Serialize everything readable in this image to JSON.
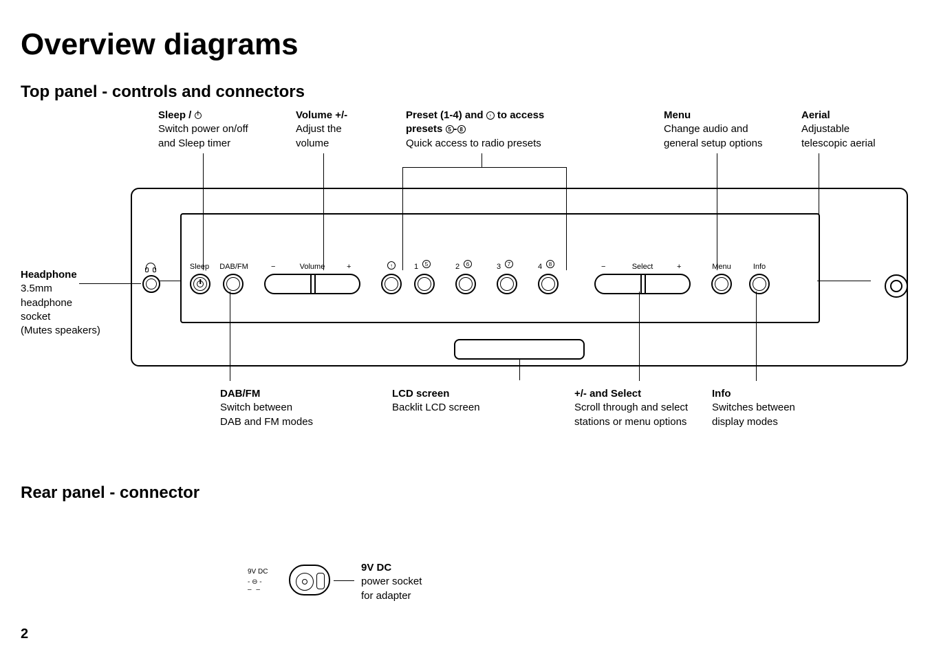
{
  "title": "Overview diagrams",
  "section1_title": "Top panel - controls  and connectors",
  "section2_title": "Rear panel - connector",
  "page_number": "2",
  "top_callouts": {
    "sleep": {
      "title": "Sleep / ",
      "desc1": "Switch power on/off",
      "desc2": "and Sleep timer"
    },
    "volume": {
      "title": "Volume +/-",
      "desc1": "Adjust the",
      "desc2": "volume"
    },
    "preset": {
      "title_a": "Preset (1-4) and",
      "title_b": "to access",
      "title2_a": "presets ",
      "title2_b": "-",
      "desc": "Quick access to radio presets"
    },
    "menu": {
      "title": "Menu",
      "desc1": "Change audio and",
      "desc2": "general setup options"
    },
    "aerial": {
      "title": "Aerial",
      "desc1": "Adjustable",
      "desc2": "telescopic aerial"
    }
  },
  "left_callout": {
    "title": "Headphone",
    "desc1": "3.5mm",
    "desc2": "headphone",
    "desc3": "socket",
    "desc4": "(Mutes speakers)"
  },
  "bottom_callouts": {
    "dabfm": {
      "title": "DAB/FM",
      "desc1": "Switch between",
      "desc2": "DAB and FM modes"
    },
    "lcd": {
      "title": "LCD screen",
      "desc": "Backlit LCD screen"
    },
    "select": {
      "title": "+/- and Select",
      "desc1": "Scroll through and select",
      "desc2": "stations or menu options"
    },
    "info": {
      "title": "Info",
      "desc1": "Switches between",
      "desc2": "display modes"
    }
  },
  "panel_labels": {
    "sleep": "Sleep",
    "dabfm": "DAB/FM",
    "volume": "Volume",
    "minus": "−",
    "plus": "+",
    "select": "Select",
    "menu": "Menu",
    "info": "Info",
    "preset_nums": [
      "1",
      "2",
      "3",
      "4"
    ],
    "preset_circles": [
      "5",
      "6",
      "7",
      "8"
    ],
    "shift_arrow": "↑"
  },
  "rear": {
    "dc_small": "9V DC",
    "title": "9V DC",
    "desc1": "power socket",
    "desc2": "for adapter"
  }
}
